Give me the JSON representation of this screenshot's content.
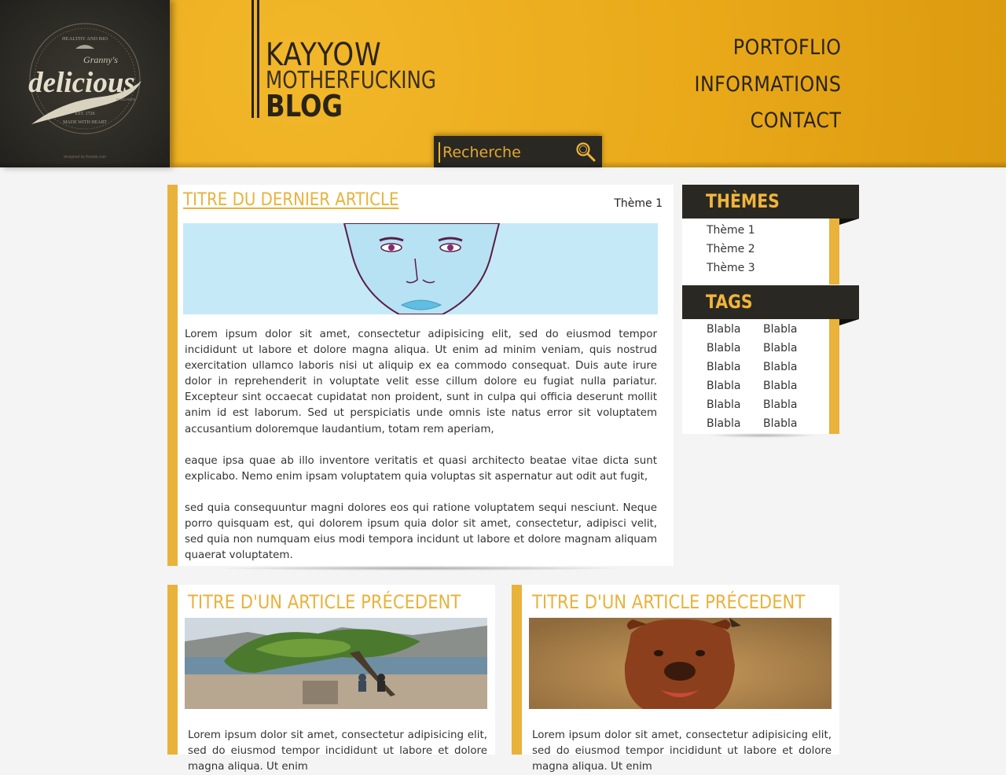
{
  "logo": {
    "top_line": "HEALTHY AND BIO",
    "script_small": "Granny's",
    "script_big": "delicious",
    "subline": "PANCAKES",
    "est": "EST. 1726",
    "bottom_line": "MADE WITH HEART",
    "credit": "designed by freepik.com"
  },
  "brand": {
    "line1": "KAYYOW",
    "line2": "MOTHERFUCKING",
    "line3": "BLOG"
  },
  "nav": [
    "PORTOFLIO",
    "INFORMATIONS",
    "CONTACT"
  ],
  "search": {
    "placeholder": "Recherche",
    "icon": "search-icon"
  },
  "main_article": {
    "title": "TITRE DU DERNIER ARTICLE",
    "theme": "Thème 1",
    "paragraphs": [
      "Lorem ipsum dolor sit amet, consectetur adipisicing elit, sed do eiusmod tempor incididunt ut labore et dolore magna aliqua. Ut enim ad minim veniam, quis nostrud exercitation ullamco laboris nisi ut aliquip ex ea commodo consequat. Duis aute irure dolor in reprehenderit in voluptate velit esse cillum dolore eu fugiat nulla pariatur. Excepteur sint occaecat cupidatat non proident, sunt in culpa qui officia deserunt mollit anim id est laborum. Sed ut perspiciatis unde omnis iste natus error sit voluptatem accusantium doloremque laudantium, totam rem aperiam,",
      "eaque ipsa quae ab illo inventore veritatis et quasi architecto beatae vitae dicta sunt explicabo. Nemo enim ipsam voluptatem quia voluptas sit aspernatur aut odit aut fugit,",
      "sed quia consequuntur magni dolores eos qui ratione voluptatem sequi nesciunt. Neque porro quisquam est, qui dolorem ipsum quia dolor sit amet, consectetur, adipisci velit, sed quia non numquam eius modi tempora incidunt ut labore et dolore magnam aliquam quaerat voluptatem."
    ]
  },
  "sidebar": {
    "themes_title": "THÈMES",
    "themes": [
      "Thème 1",
      "Thème 2",
      "Thème 3"
    ],
    "tags_title": "TAGS",
    "tags": [
      "Blabla",
      "Blabla",
      "Blabla",
      "Blabla",
      "Blabla",
      "Blabla",
      "Blabla",
      "Blabla",
      "Blabla",
      "Blabla",
      "Blabla",
      "Blabla"
    ]
  },
  "previous_articles": [
    {
      "title": "TITRE D'UN ARTICLE PRÉCEDENT",
      "text": "Lorem ipsum dolor sit amet, consectetur adipisicing elit, sed do eiusmod tempor incididunt ut labore et dolore magna aliqua. Ut enim"
    },
    {
      "title": "TITRE D'UN ARTICLE PRÉCEDENT",
      "text": "Lorem ipsum dolor sit amet, consectetur adipisicing elit, sed do eiusmod tempor incididunt ut labore et dolore magna aliqua. Ut enim"
    }
  ],
  "colors": {
    "accent": "#e9b23b",
    "dark": "#2a2823",
    "header": "#eaa91a"
  }
}
